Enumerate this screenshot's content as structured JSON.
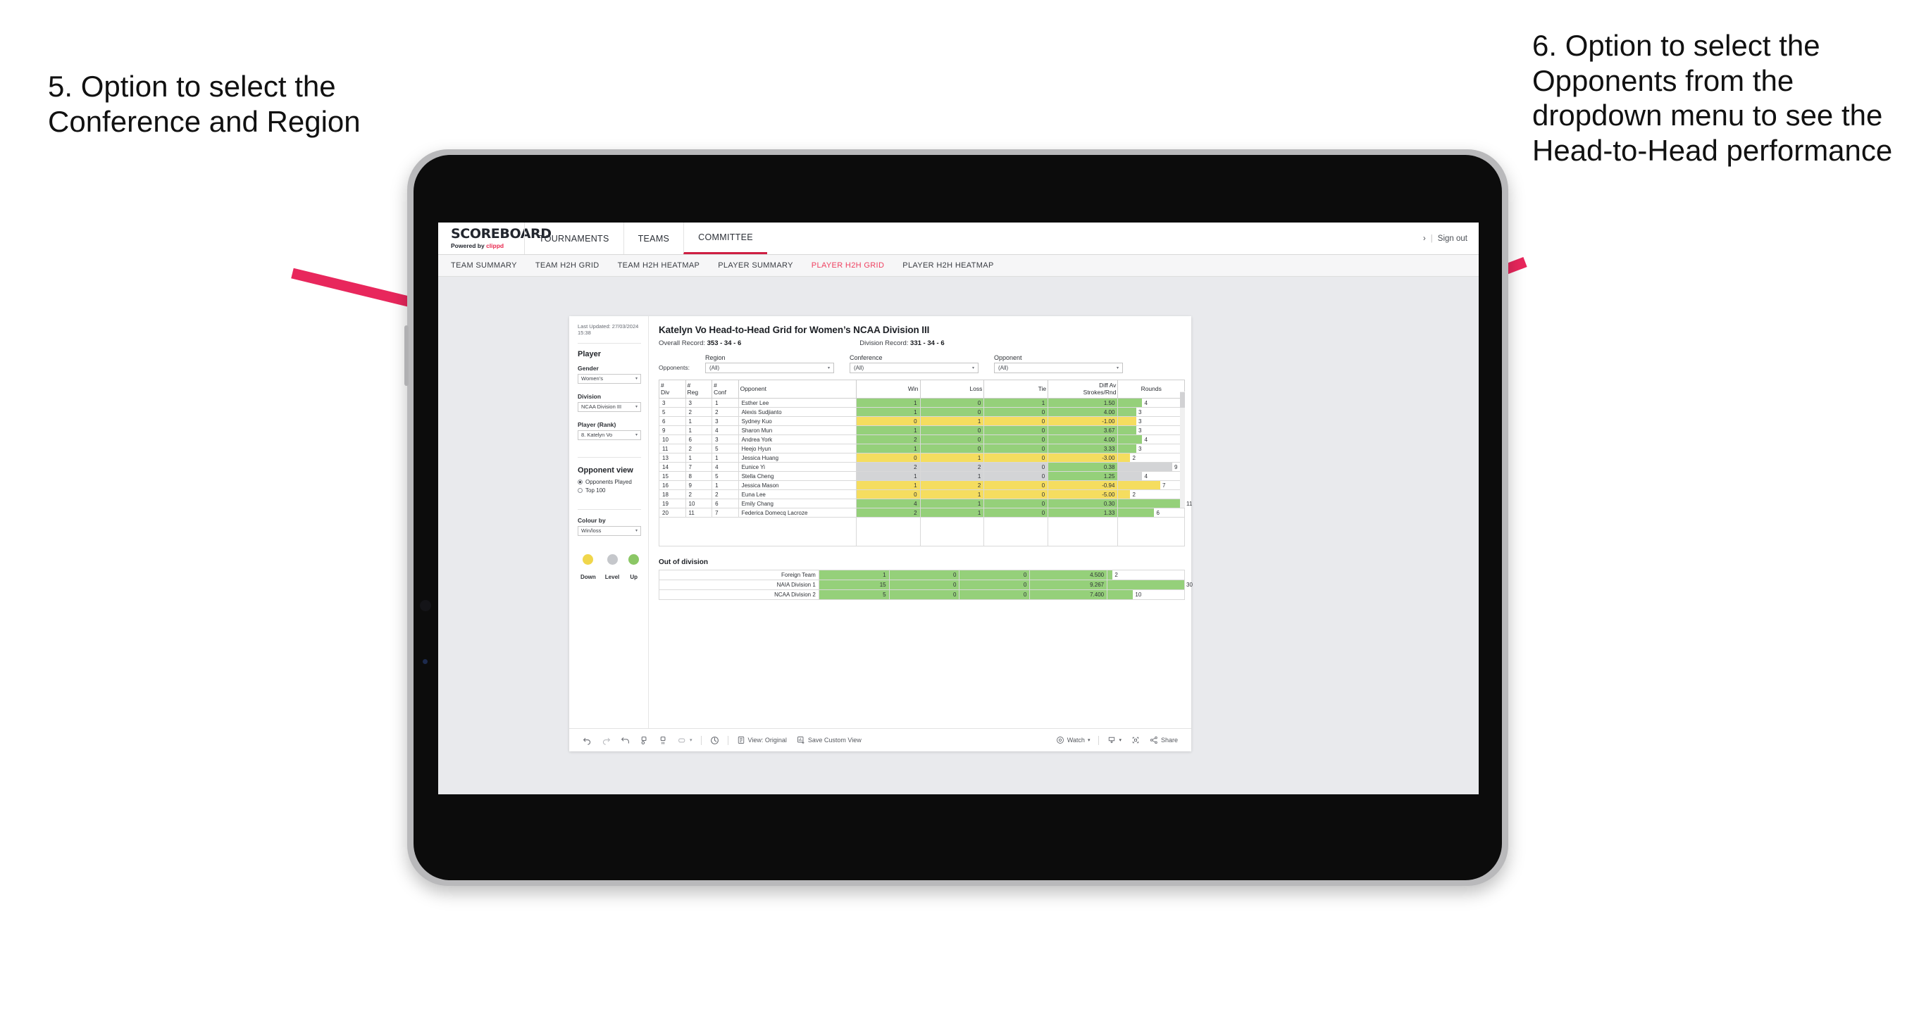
{
  "annotations": {
    "left": "5. Option to select the Conference and Region",
    "right": "6. Option to select the Opponents from the dropdown menu to see the Head-to-Head performance",
    "arrow_color": "#e8275c"
  },
  "app": {
    "logo_main": "SCOREBOARD",
    "logo_sub_prefix": "Powered by ",
    "logo_sub_brand": "clippd",
    "nav_tabs": [
      {
        "label": "TOURNAMENTS",
        "active": false
      },
      {
        "label": "TEAMS",
        "active": false
      },
      {
        "label": "COMMITTEE",
        "active": true
      }
    ],
    "chevron": "›",
    "separator": "|",
    "sign_out": "Sign out",
    "sub_tabs": [
      {
        "label": "TEAM SUMMARY",
        "active": false
      },
      {
        "label": "TEAM H2H GRID",
        "active": false
      },
      {
        "label": "TEAM H2H HEATMAP",
        "active": false
      },
      {
        "label": "PLAYER SUMMARY",
        "active": false
      },
      {
        "label": "PLAYER H2H GRID",
        "active": true
      },
      {
        "label": "PLAYER H2H HEATMAP",
        "active": false
      }
    ],
    "accent_color": "#ef4060"
  },
  "sidebar": {
    "last_updated": "Last Updated: 27/03/2024 15:38",
    "player_heading": "Player",
    "gender_label": "Gender",
    "gender_value": "Women’s",
    "division_label": "Division",
    "division_value": "NCAA Division III",
    "player_rank_label": "Player (Rank)",
    "player_rank_value": "8. Katelyn Vo",
    "opponent_view_heading": "Opponent view",
    "opponent_view_options": [
      {
        "label": "Opponents Played",
        "selected": true
      },
      {
        "label": "Top 100",
        "selected": false
      }
    ],
    "colour_by_label": "Colour by",
    "colour_by_value": "Win/loss",
    "legend": [
      {
        "label": "Down",
        "color": "#f0d64b"
      },
      {
        "label": "Level",
        "color": "#c5c7cb"
      },
      {
        "label": "Up",
        "color": "#8bc765"
      }
    ]
  },
  "view": {
    "title": "Katelyn Vo Head-to-Head Grid for Women’s NCAA Division III",
    "overall_record_label": "Overall Record: ",
    "overall_record_value": "353 - 34 - 6",
    "division_record_label": "Division Record: ",
    "division_record_value": "331 - 34 - 6",
    "opponents_label": "Opponents:",
    "filters": [
      {
        "caption": "Region",
        "value": "(All)"
      },
      {
        "caption": "Conference",
        "value": "(All)"
      },
      {
        "caption": "Opponent",
        "value": "(All)"
      }
    ],
    "chevron_glyph": "▾"
  },
  "chart_data": {
    "type": "table",
    "title": "Katelyn Vo Head-to-Head Grid for Women’s NCAA Division III",
    "columns": [
      "# Div",
      "# Reg",
      "# Conf",
      "Opponent",
      "Win",
      "Loss",
      "Tie",
      "Diff Av Strokes/Rnd",
      "Rounds"
    ],
    "column_header_lines": [
      [
        "#",
        "Div"
      ],
      [
        "#",
        "Reg"
      ],
      [
        "#",
        "Conf"
      ],
      [
        "Opponent"
      ],
      [
        "Win"
      ],
      [
        "Loss"
      ],
      [
        "Tie"
      ],
      [
        "Diff Av",
        "Strokes/Rnd"
      ],
      [
        "Rounds"
      ]
    ],
    "rounds_max": 11,
    "rows": [
      {
        "div": "3",
        "reg": "3",
        "conf": "1",
        "opponent": "Esther Lee",
        "win": "1",
        "loss": "0",
        "tie": "1",
        "diff": "1.50",
        "rounds": 4,
        "state": "win"
      },
      {
        "div": "5",
        "reg": "2",
        "conf": "2",
        "opponent": "Alexis Sudjianto",
        "win": "1",
        "loss": "0",
        "tie": "0",
        "diff": "4.00",
        "rounds": 3,
        "state": "win"
      },
      {
        "div": "6",
        "reg": "1",
        "conf": "3",
        "opponent": "Sydney Kuo",
        "win": "0",
        "loss": "1",
        "tie": "0",
        "diff": "-1.00",
        "rounds": 3,
        "state": "loss"
      },
      {
        "div": "9",
        "reg": "1",
        "conf": "4",
        "opponent": "Sharon Mun",
        "win": "1",
        "loss": "0",
        "tie": "0",
        "diff": "3.67",
        "rounds": 3,
        "state": "win"
      },
      {
        "div": "10",
        "reg": "6",
        "conf": "3",
        "opponent": "Andrea York",
        "win": "2",
        "loss": "0",
        "tie": "0",
        "diff": "4.00",
        "rounds": 4,
        "state": "win"
      },
      {
        "div": "11",
        "reg": "2",
        "conf": "5",
        "opponent": "Heejo Hyun",
        "win": "1",
        "loss": "0",
        "tie": "0",
        "diff": "3.33",
        "rounds": 3,
        "state": "win"
      },
      {
        "div": "13",
        "reg": "1",
        "conf": "1",
        "opponent": "Jessica Huang",
        "win": "0",
        "loss": "1",
        "tie": "0",
        "diff": "-3.00",
        "rounds": 2,
        "state": "loss"
      },
      {
        "div": "14",
        "reg": "7",
        "conf": "4",
        "opponent": "Eunice Yi",
        "win": "2",
        "loss": "2",
        "tie": "0",
        "diff": "0.38",
        "rounds": 9,
        "state": "level",
        "diff_state": "win"
      },
      {
        "div": "15",
        "reg": "8",
        "conf": "5",
        "opponent": "Stella Cheng",
        "win": "1",
        "loss": "1",
        "tie": "0",
        "diff": "1.25",
        "rounds": 4,
        "state": "level",
        "diff_state": "win"
      },
      {
        "div": "16",
        "reg": "9",
        "conf": "1",
        "opponent": "Jessica Mason",
        "win": "1",
        "loss": "2",
        "tie": "0",
        "diff": "-0.94",
        "rounds": 7,
        "state": "loss"
      },
      {
        "div": "18",
        "reg": "2",
        "conf": "2",
        "opponent": "Euna Lee",
        "win": "0",
        "loss": "1",
        "tie": "0",
        "diff": "-5.00",
        "rounds": 2,
        "state": "loss"
      },
      {
        "div": "19",
        "reg": "10",
        "conf": "6",
        "opponent": "Emily Chang",
        "win": "4",
        "loss": "1",
        "tie": "0",
        "diff": "0.30",
        "rounds": 11,
        "state": "win"
      },
      {
        "div": "20",
        "reg": "11",
        "conf": "7",
        "opponent": "Federica Domecq Lacroze",
        "win": "2",
        "loss": "1",
        "tie": "0",
        "diff": "1.33",
        "rounds": 6,
        "state": "win"
      }
    ],
    "out_of_division": {
      "title": "Out of division",
      "rounds_max": 30,
      "rows": [
        {
          "name": "Foreign Team",
          "win": "1",
          "loss": "0",
          "tie": "0",
          "diff": "4.500",
          "rounds": 2,
          "state": "win"
        },
        {
          "name": "NAIA Division 1",
          "win": "15",
          "loss": "0",
          "tie": "0",
          "diff": "9.267",
          "rounds": 30,
          "state": "win"
        },
        {
          "name": "NCAA Division 2",
          "win": "5",
          "loss": "0",
          "tie": "0",
          "diff": "7.400",
          "rounds": 10,
          "state": "win"
        }
      ]
    },
    "colors": {
      "win": "#95d07a",
      "loss": "#f5dd5f",
      "level": "#d3d4d6"
    }
  },
  "toolbar": {
    "view_original": "View: Original",
    "save_custom_view": "Save Custom View",
    "watch": "Watch",
    "share": "Share",
    "dropdown_glyph": "▾"
  }
}
